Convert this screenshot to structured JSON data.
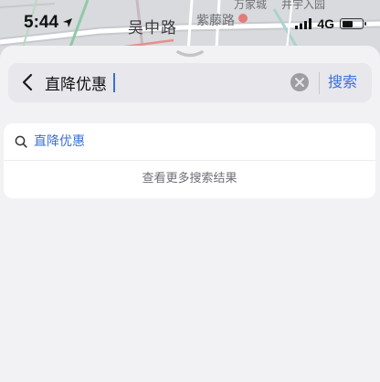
{
  "status_bar": {
    "time": "5:44",
    "network": "4G",
    "battery_level": 0.55
  },
  "map": {
    "labels": {
      "road_main": "吴中路",
      "road_side": "紫藤路",
      "poi_1": "万家城",
      "poi_2": "井宇入园"
    }
  },
  "search": {
    "query": "直降优惠",
    "submit_label": "搜索"
  },
  "results": {
    "suggestion": "直降优惠",
    "more_label": "查看更多搜索结果"
  },
  "colors": {
    "accent": "#3a6fd8",
    "sheet_bg": "#f2f2f4",
    "card_bg": "#ffffff"
  }
}
